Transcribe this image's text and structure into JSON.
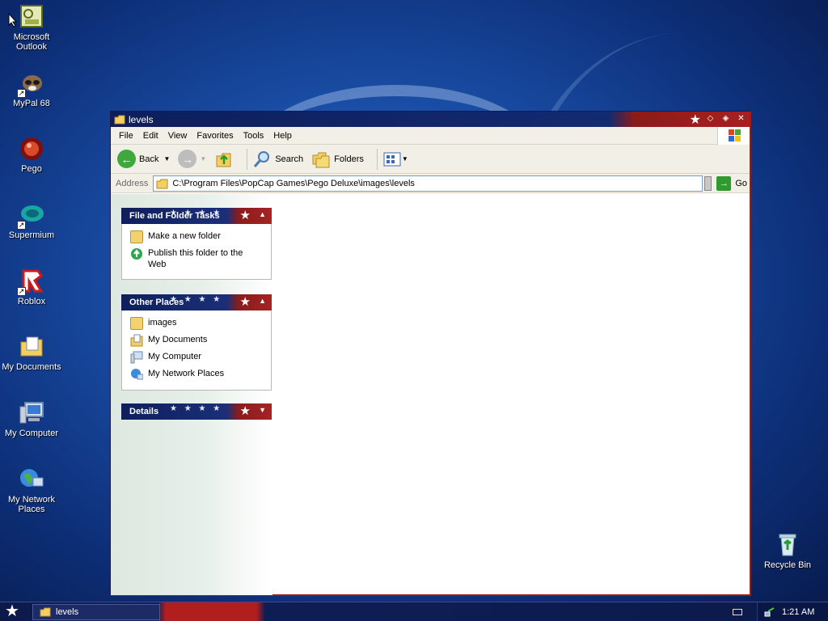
{
  "desktop": {
    "icons": [
      {
        "label": "Microsoft Outlook",
        "icon": "outlook-icon"
      },
      {
        "label": "MyPal 68",
        "icon": "mypal-icon"
      },
      {
        "label": "Pego",
        "icon": "pego-icon"
      },
      {
        "label": "Supermium",
        "icon": "supermium-icon"
      },
      {
        "label": "Roblox",
        "icon": "roblox-icon"
      },
      {
        "label": "My Documents",
        "icon": "my-documents-icon"
      },
      {
        "label": "My Computer",
        "icon": "my-computer-icon"
      },
      {
        "label": "My Network Places",
        "icon": "my-network-places-icon"
      },
      {
        "label": "Recycle Bin",
        "icon": "recycle-bin-icon"
      }
    ]
  },
  "window": {
    "title": "levels",
    "menu": [
      "File",
      "Edit",
      "View",
      "Favorites",
      "Tools",
      "Help"
    ],
    "toolbar": {
      "back": "Back",
      "search": "Search",
      "folders": "Folders"
    },
    "address": {
      "label": "Address",
      "value": "C:\\Program Files\\PopCap Games\\Pego Deluxe\\images\\levels",
      "go": "Go"
    },
    "panels": {
      "tasks": {
        "title": "File and Folder Tasks",
        "items": [
          "Make a new folder",
          "Publish this folder to the Web"
        ]
      },
      "places": {
        "title": "Other Places",
        "items": [
          "images",
          "My Documents",
          "My Computer",
          "My Network Places"
        ]
      },
      "details": {
        "title": "Details"
      }
    }
  },
  "taskbar": {
    "item": "levels",
    "clock": "1:21 AM"
  },
  "colors": {
    "titlebar_blue": "#0d1e5a",
    "titlebar_red": "#a82020",
    "chrome": "#f1efe6"
  }
}
